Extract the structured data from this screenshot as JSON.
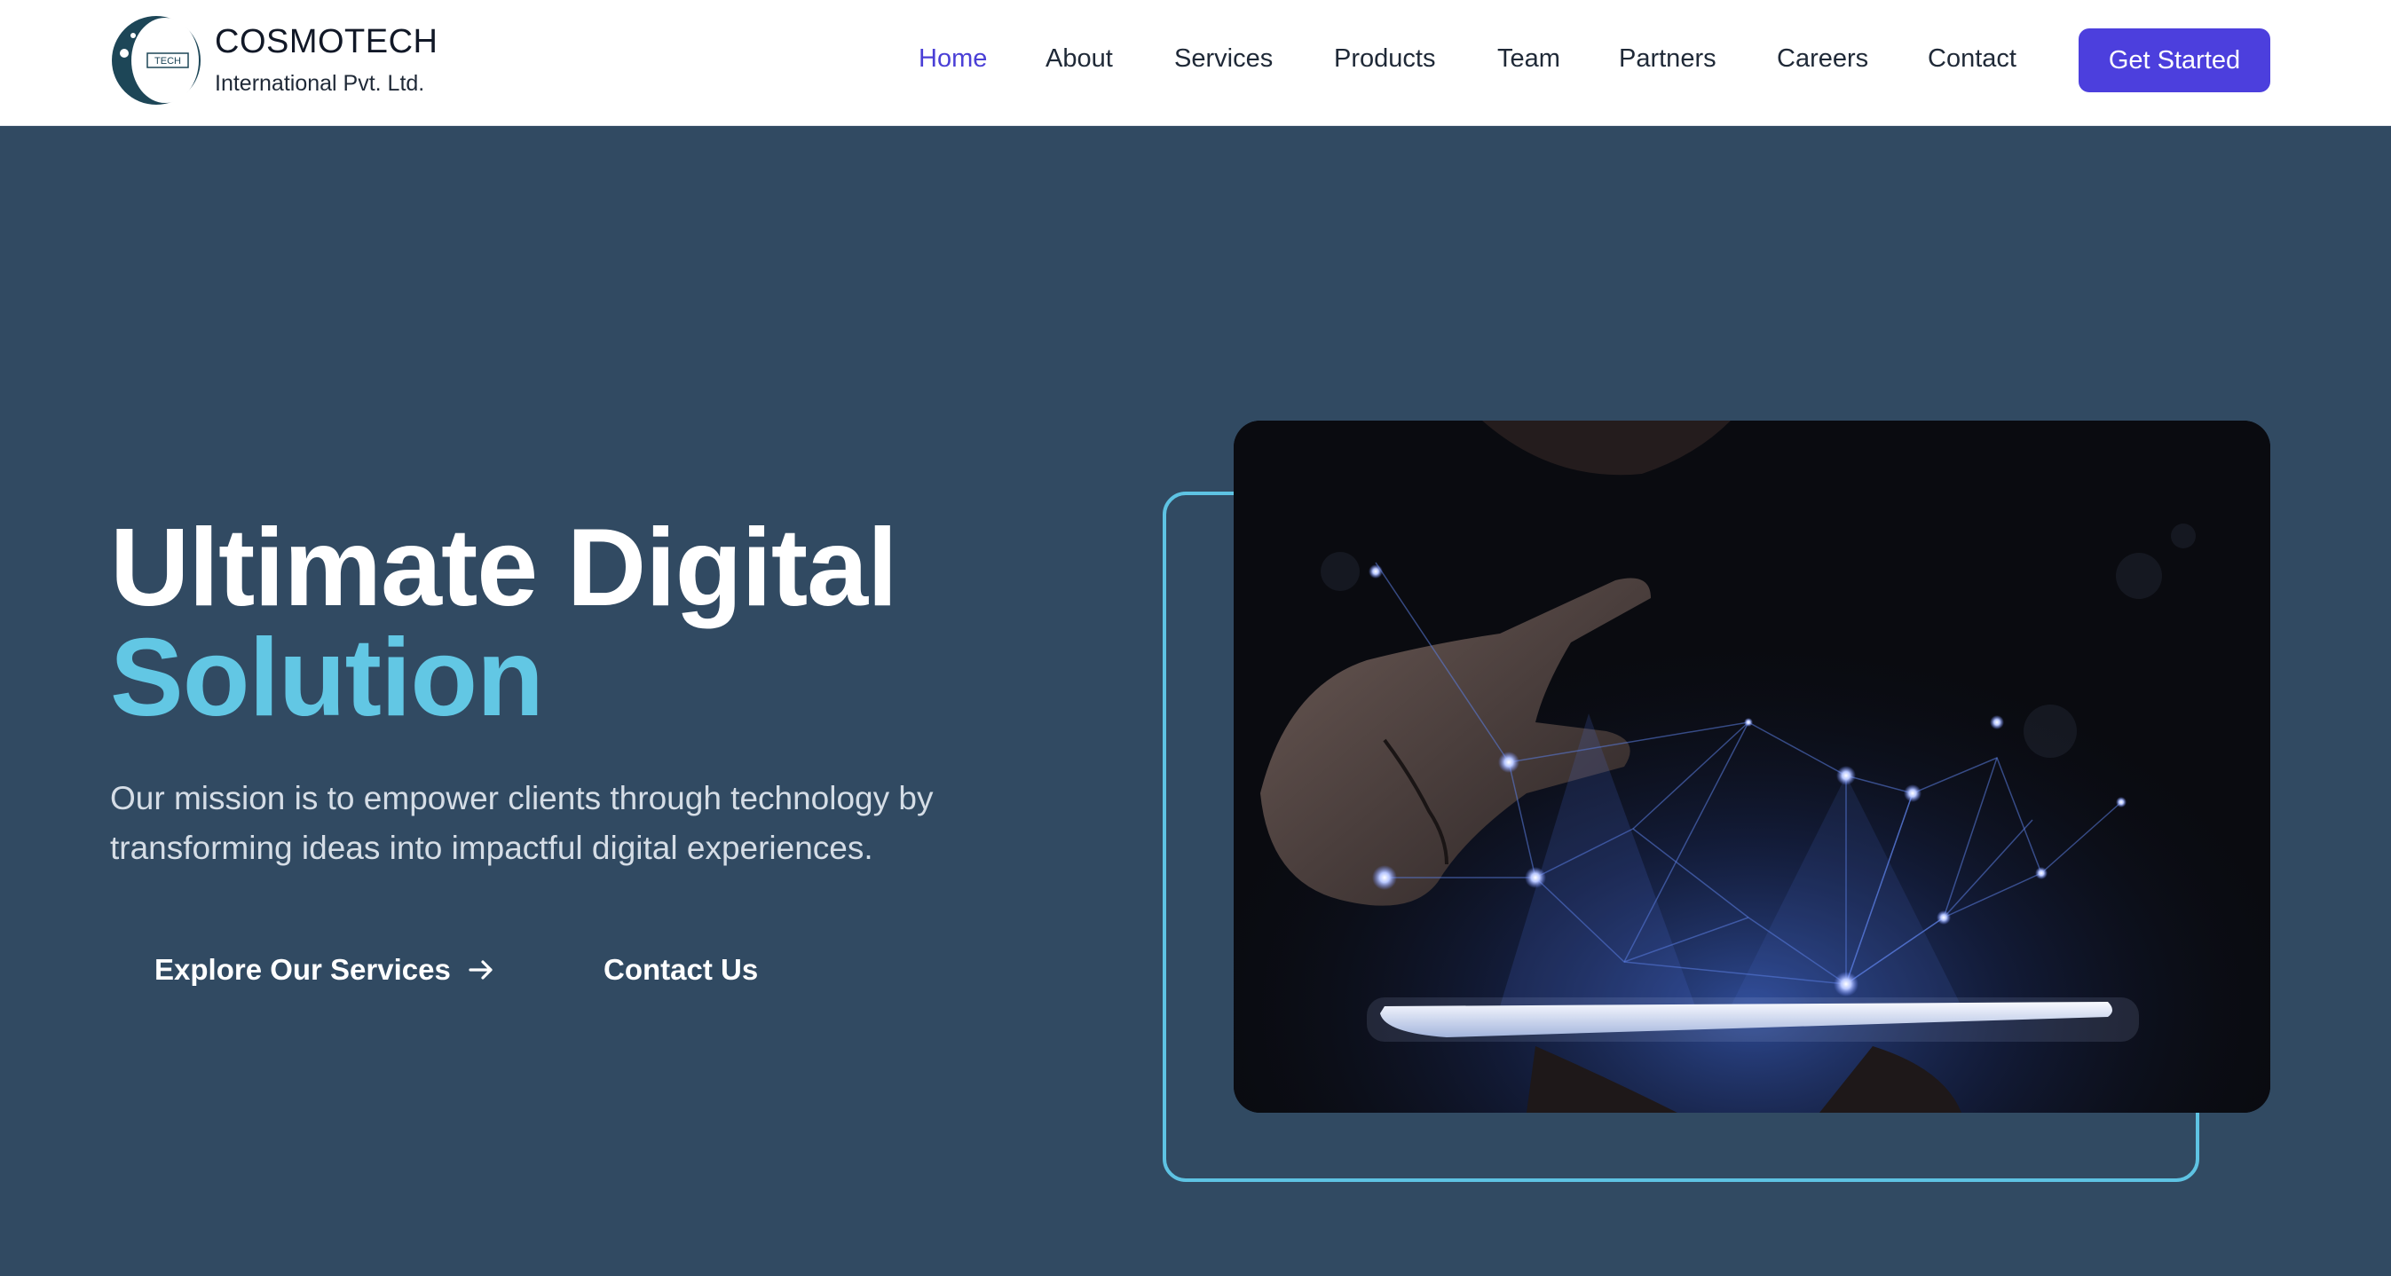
{
  "brand": {
    "logo_text": "TECH",
    "name": "COSMOTECH",
    "subtitle": "International Pvt. Ltd."
  },
  "nav": {
    "items": [
      {
        "label": "Home",
        "active": true
      },
      {
        "label": "About",
        "active": false
      },
      {
        "label": "Services",
        "active": false
      },
      {
        "label": "Products",
        "active": false
      },
      {
        "label": "Team",
        "active": false
      },
      {
        "label": "Partners",
        "active": false
      },
      {
        "label": "Careers",
        "active": false
      },
      {
        "label": "Contact",
        "active": false
      }
    ],
    "cta_label": "Get Started"
  },
  "hero": {
    "title_line1": "Ultimate Digital",
    "title_line2": "Solution",
    "description": "Our mission is to empower clients through technology by transforming ideas into impactful digital experiences.",
    "primary_button": "Explore Our Services",
    "secondary_button": "Contact Us"
  },
  "colors": {
    "accent": "#4c3fdd",
    "highlight": "#62c7e4",
    "background": "#314a62"
  },
  "icons": {
    "arrow": "arrow-right-icon"
  }
}
